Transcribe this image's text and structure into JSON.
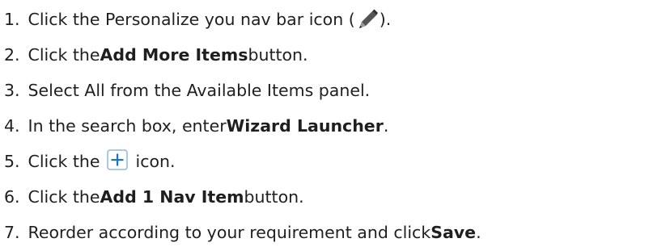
{
  "steps": [
    {
      "number": "1",
      "text_before": "Click the Personalize you nav bar icon (",
      "icon": "pencil-icon",
      "text_after": ")."
    },
    {
      "number": "2",
      "text_before": "Click the ",
      "bold": "Add More Items",
      "text_after": " button."
    },
    {
      "number": "3",
      "text": "Select All from the Available Items panel."
    },
    {
      "number": "4",
      "text_before": "In the search box, enter ",
      "bold": "Wizard Launcher",
      "text_after": "."
    },
    {
      "number": "5",
      "text_before": "Click the ",
      "icon": "plus-icon",
      "text_after": "icon."
    },
    {
      "number": "6",
      "text_before": "Click the ",
      "bold": "Add 1 Nav Item",
      "text_after": " button."
    },
    {
      "number": "7",
      "text_before": "Reorder according to your requirement and click ",
      "bold": "Save",
      "text_after": "."
    }
  ],
  "colors": {
    "text": "#1f1f1f",
    "plus_icon_border": "#8fb8de",
    "plus_icon_fg": "#1a73c7",
    "pencil_fill": "#555555"
  }
}
